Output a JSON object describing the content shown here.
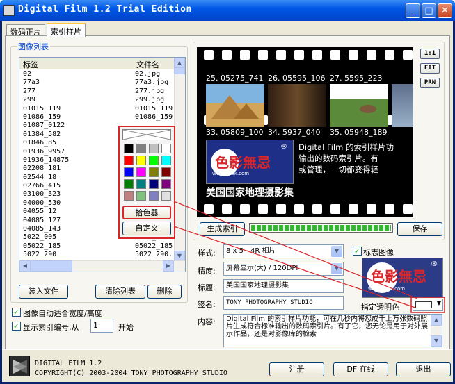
{
  "window": {
    "title": "Digital Film 1.2 Trial Edition",
    "minimize": "_",
    "maximize": "□",
    "close": "✕"
  },
  "tabs": [
    {
      "label": "数码正片"
    },
    {
      "label": "索引样片"
    }
  ],
  "image_list": {
    "group_label": "图像列表",
    "col_label": "标签",
    "col_file": "文件名",
    "rows": [
      {
        "label": "02",
        "file": "02.jpg"
      },
      {
        "label": "77a3",
        "file": "77a3.jpg"
      },
      {
        "label": "277",
        "file": "277.jpg"
      },
      {
        "label": "299",
        "file": "299.jpg"
      },
      {
        "label": "01015_119",
        "file": "01015_119"
      },
      {
        "label": "01086_159",
        "file": "01086_159"
      },
      {
        "label": "01087_0122",
        "file": ""
      },
      {
        "label": "01384_582",
        "file": ""
      },
      {
        "label": "01846_85",
        "file": ""
      },
      {
        "label": "01936_9957",
        "file": ""
      },
      {
        "label": "01936_14875",
        "file": ""
      },
      {
        "label": "02208_181",
        "file": ""
      },
      {
        "label": "02544_18",
        "file": ""
      },
      {
        "label": "02766_415",
        "file": ""
      },
      {
        "label": "03100_323",
        "file": ""
      },
      {
        "label": "04000_530",
        "file": ""
      },
      {
        "label": "04055_12",
        "file": ""
      },
      {
        "label": "04085_127",
        "file": ""
      },
      {
        "label": "04085_143",
        "file": ""
      },
      {
        "label": "5022_005",
        "file": "5022_005."
      },
      {
        "label": "05022_185",
        "file": "05022_185"
      },
      {
        "label": "5022_290",
        "file": "5022_290."
      }
    ]
  },
  "color_popup": {
    "pick_label": "拾色器",
    "custom_label": "自定义",
    "colors": [
      "#000000",
      "#808080",
      "#c0c0c0",
      "#ffffff",
      "#ff0000",
      "#ffff00",
      "#00ff00",
      "#00ffff",
      "#0000ff",
      "#ff00ff",
      "#808000",
      "#800000",
      "#008000",
      "#008080",
      "#000080",
      "#800080",
      "#c08080",
      "#80c080",
      "#8080c0",
      "#e0e0e0"
    ]
  },
  "list_buttons": {
    "load": "装入文件",
    "clear": "清除列表",
    "delete": "删除"
  },
  "options": {
    "auto_fit": "图像自动适合宽度/高度",
    "show_index": "显示索引编号,从",
    "start_value": "1",
    "start_label": "开始"
  },
  "preview": {
    "captions_top": [
      "25. 05275_741",
      "26. 05595_106",
      "27. 5595_223",
      ""
    ],
    "captions_mid": [
      "33. 05809_100",
      "34. 5937_040",
      "35. 05948_189",
      ""
    ],
    "banner_text_lines": [
      "Digital Film 的索引样片功",
      "输出的数码索引片。有",
      "或管理，一切都变得轻"
    ],
    "logo_text": "色影無忌",
    "logo_sub": "www.xitek.com",
    "logo_reg": "®",
    "title_text": "美国国家地理摄影集"
  },
  "side_buttons": [
    "1:1",
    "FIT",
    "PRN"
  ],
  "actions": {
    "generate": "生成索引",
    "save": "保存",
    "progress_percent": 100
  },
  "form": {
    "style_label": "样式:",
    "style_value": "8 x 5 - 4R 相片",
    "precision_label": "精度:",
    "precision_value": "屏幕显示(大) / 120DPI",
    "title_label": "标题:",
    "title_value": "美国国家地理摄影集",
    "sign_label": "签名:",
    "sign_value": "TONY PHOTOGRAPHY STUDIO",
    "content_label": "内容:",
    "content_value": "Digital Film 的索引样片功能，可在几秒内将您成千上万张数码照片生成符合标准输出的数码索引片。有了它，您无论是用于对外展示作品，还是对影像库的检索"
  },
  "logo_panel": {
    "checkbox_label": "标志图像",
    "transparent_label": "指定透明色"
  },
  "footer": {
    "app": "DIGITAL FILM 1.2",
    "copyright": "COPYRIGHT(C) 2003-2004 TONY PHOTOGRAPHY STUDIO",
    "register": "注册",
    "online": "DF 在线",
    "exit": "退出"
  },
  "colors": {
    "title_bar": "#0058e6",
    "accent_red": "#d8262a",
    "link_blue": "#0046d5"
  }
}
